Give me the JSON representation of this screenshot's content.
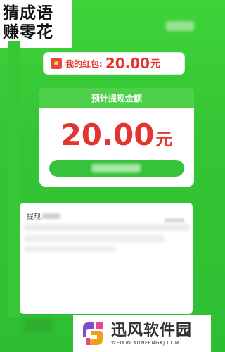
{
  "banner": {
    "line1": "猜成语",
    "line2": "赚零花"
  },
  "red_packet": {
    "label": "我的红包:",
    "amount": "20.00",
    "unit": "元"
  },
  "withdraw_card": {
    "header": "预计提现金额",
    "amount": "20.00",
    "unit": "元"
  },
  "record_card": {
    "title": "提现"
  },
  "watermark": {
    "title": "迅风软件园",
    "url": "WEIXIN.XUNFENGKJ.COM"
  },
  "colors": {
    "background_green": "#34c535",
    "accent_red": "#e3342f",
    "button_green": "#37c23b"
  }
}
